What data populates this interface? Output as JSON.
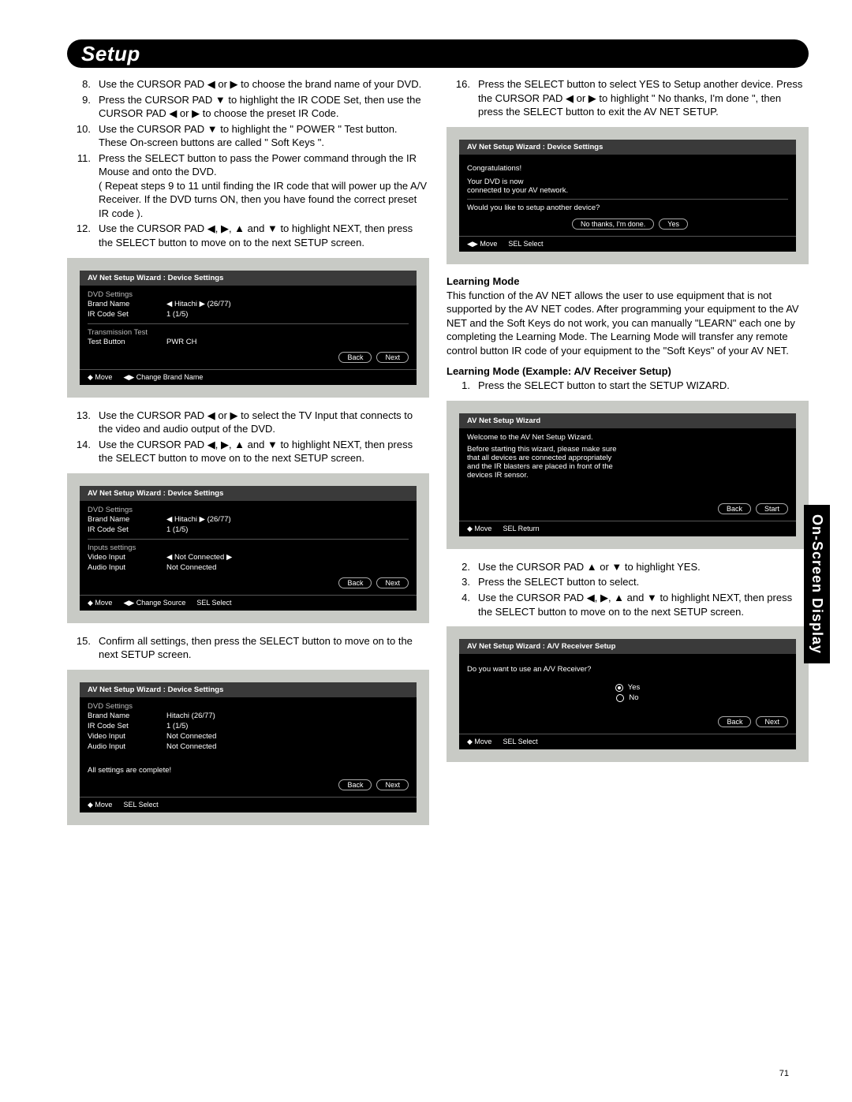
{
  "page_number": "71",
  "side_tab": "On-Screen Display",
  "title": "Setup",
  "left": {
    "steps_a": [
      {
        "n": "8.",
        "t": "Use the CURSOR PAD ◀ or ▶ to choose the brand name of your DVD."
      },
      {
        "n": "9.",
        "t": "Press the CURSOR PAD ▼ to highlight the IR CODE Set, then use the CURSOR PAD ◀ or ▶ to choose the preset IR Code."
      },
      {
        "n": "10.",
        "t": "Use the CURSOR PAD ▼ to highlight the \" POWER \" Test button.\nThese On-screen buttons are called \" Soft Keys \"."
      },
      {
        "n": "11.",
        "t": "Press the SELECT button to pass the Power command through the IR Mouse and onto the DVD.\n( Repeat steps 9 to 11 until finding the IR code that will power up  the A/V Receiver. If the DVD turns ON, then you have found the correct preset IR code )."
      },
      {
        "n": "12.",
        "t": "Use the CURSOR PAD ◀, ▶, ▲ and ▼ to highlight NEXT, then press the SELECT button to move on to the next SETUP screen."
      }
    ],
    "steps_b": [
      {
        "n": "13.",
        "t": "Use the CURSOR PAD ◀ or ▶ to select the TV Input that connects to the video and audio output of the DVD."
      },
      {
        "n": "14.",
        "t": "Use the CURSOR PAD ◀, ▶, ▲ and ▼ to highlight NEXT, then press the SELECT button to move on to the next SETUP screen."
      }
    ],
    "steps_c": [
      {
        "n": "15.",
        "t": "Confirm all settings, then  press the SELECT button to move on to the next SETUP screen."
      }
    ],
    "screen1": {
      "title": "AV Net Setup Wizard : Device Settings",
      "section1": "DVD Settings",
      "r1l": "Brand Name",
      "r1v": "◀  Hitachi     ▶ (26/77)",
      "r2l": "IR Code Set",
      "r2v": "1          (1/5)",
      "section2": "Transmission Test",
      "r3l": "Test Button",
      "r3v": "PWR                         CH",
      "back": "Back",
      "next": "Next",
      "f1": "◆ Move",
      "f2": "◀▶ Change Brand Name"
    },
    "screen2": {
      "title": "AV Net Setup Wizard : Device Settings",
      "section1": "DVD Settings",
      "r1l": "Brand Name",
      "r1v": "◀  Hitachi  ▶  (26/77)",
      "r2l": "IR Code Set",
      "r2v": "1        (1/5)",
      "section2": "Inputs settings",
      "r3l": "Video Input",
      "r3v": "◀  Not Connected  ▶",
      "r4l": "Audio Input",
      "r4v": "Not Connected",
      "back": "Back",
      "next": "Next",
      "f1": "◆ Move",
      "f2": "◀▶ Change Source",
      "f3": "SEL Select"
    },
    "screen3": {
      "title": "AV Net Setup Wizard : Device Settings",
      "section1": "DVD Settings",
      "r1l": "Brand Name",
      "r1v": "Hitachi        (26/77)",
      "r2l": "IR Code Set",
      "r2v": "1      (1/5)",
      "r3l": "Video Input",
      "r3v": "Not Connected",
      "r4l": "Audio Input",
      "r4v": "Not Connected",
      "msg": "All settings are complete!",
      "back": "Back",
      "next": "Next",
      "f1": "◆ Move",
      "f2": "SEL  Select"
    }
  },
  "right": {
    "steps_a": [
      {
        "n": "16.",
        "t": "Press the SELECT button to select YES to Setup another device.  Press the CURSOR PAD ◀ or ▶ to highlight \" No thanks, I'm done \", then press the SELECT button to exit the AV NET SETUP."
      }
    ],
    "screen1": {
      "title": "AV Net Setup Wizard : Device Settings",
      "l1": "Congratulations!",
      "l2": "Your DVD is now",
      "l3": "connected to your AV network.",
      "q": "Would you like to setup another device?",
      "b1": "No thanks, I'm done.",
      "b2": "Yes",
      "f1": "◀▶ Move",
      "f2": "SEL  Select"
    },
    "h1": "Learning Mode",
    "p1": "This function of the AV NET allows the user to  use  equipment that is not supported by the AV NET codes.  After programming your equipment to the AV NET and the Soft Keys do not work, you can manually \"LEARN\" each one by completing the Learning Mode.  The Learning Mode will transfer any remote control button IR code of your equipment to the \"Soft Keys\" of your AV NET.",
    "h2": "Learning Mode (Example: A/V Receiver Setup)",
    "steps_b": [
      {
        "n": "1.",
        "t": "Press the SELECT button to start the SETUP WIZARD."
      }
    ],
    "screen2": {
      "title": "AV Net Setup Wizard",
      "l1": "Welcome to the AV Net Setup Wizard.",
      "l2": "Before starting this wizard, please make sure",
      "l3": "that all devices are connected appropriately",
      "l4": "and the IR blasters are placed in front of the",
      "l5": "devices IR sensor.",
      "back": "Back",
      "start": "Start",
      "f1": "◆ Move",
      "f2": "SEL  Return"
    },
    "steps_c": [
      {
        "n": "2.",
        "t": "Use the CURSOR PAD ▲ or ▼ to highlight YES."
      },
      {
        "n": "3.",
        "t": "Press the SELECT button to select."
      },
      {
        "n": "4.",
        "t": "Use the CURSOR PAD ◀, ▶, ▲ and ▼ to highlight NEXT, then press the SELECT button to move on to the next SETUP screen."
      }
    ],
    "screen3": {
      "title": "AV Net Setup Wizard : A/V Receiver Setup",
      "q": "Do you want to use an A/V Receiver?",
      "o1": "Yes",
      "o2": "No",
      "back": "Back",
      "next": "Next",
      "f1": "◆ Move",
      "f2": "SEL  Select"
    }
  }
}
